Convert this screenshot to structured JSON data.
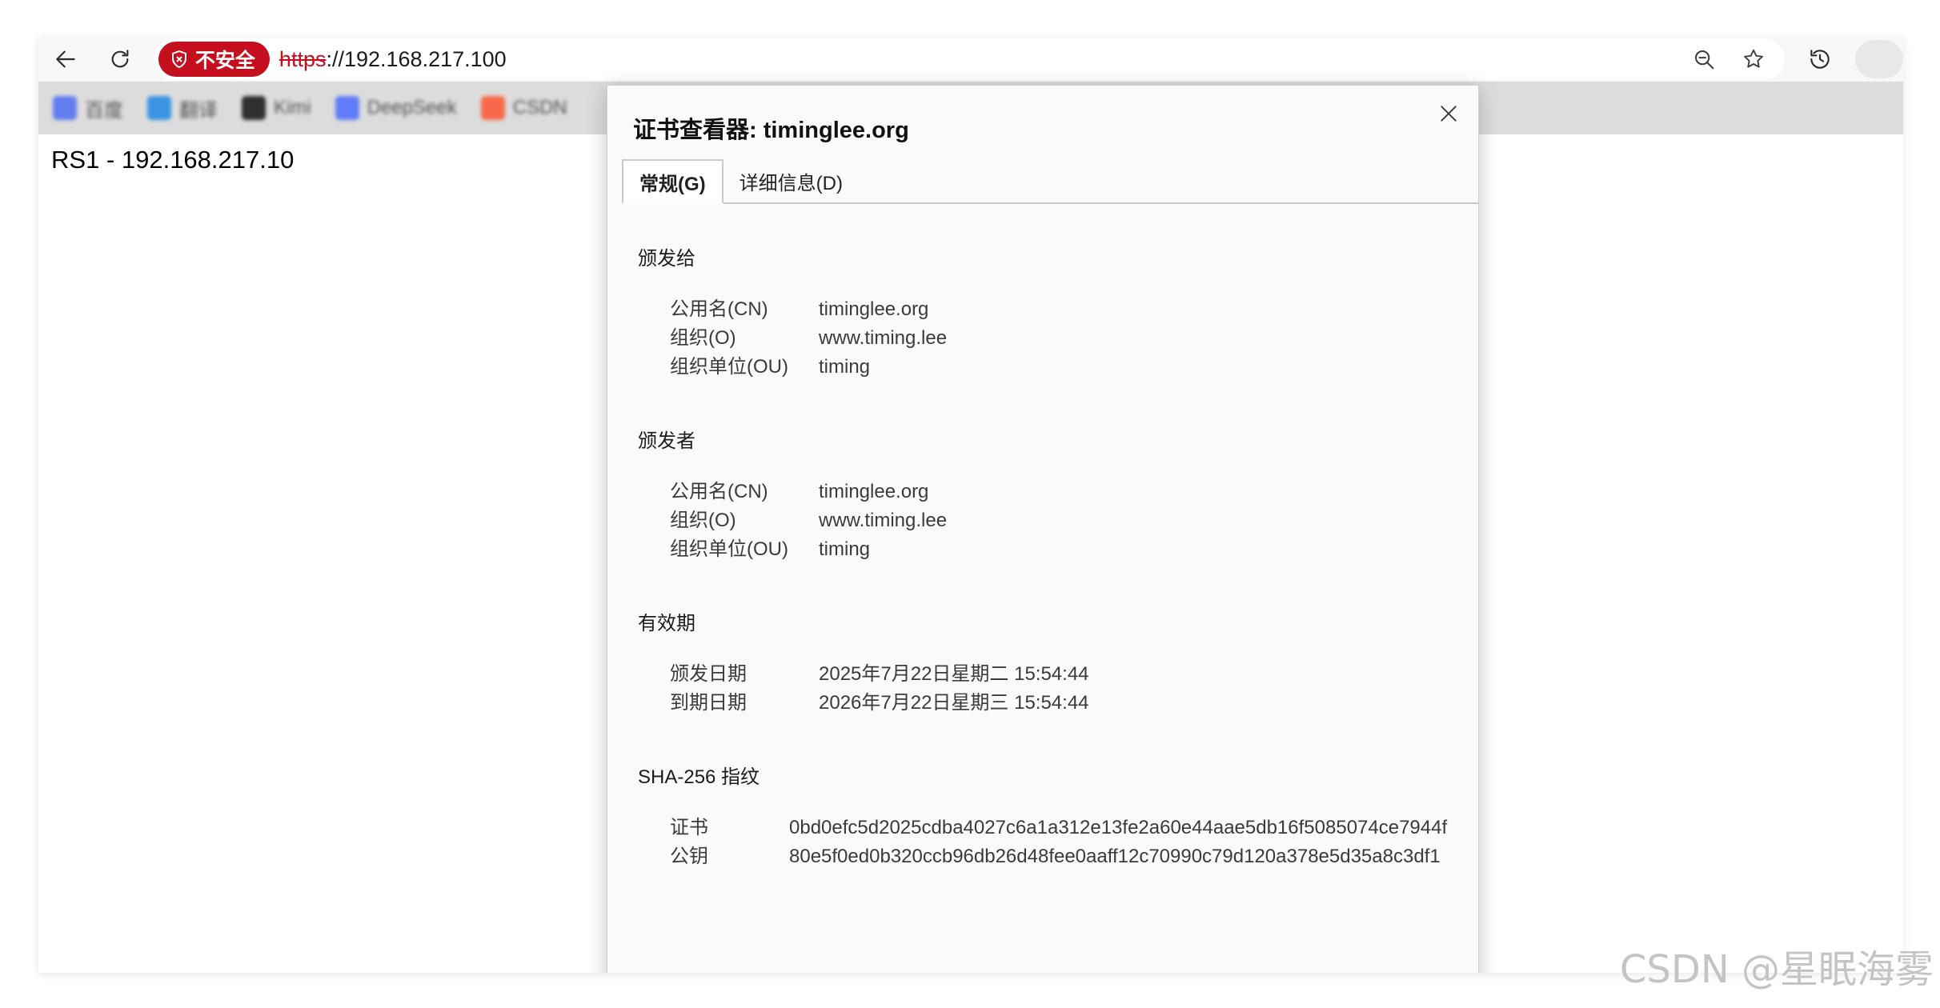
{
  "browser": {
    "security_badge": "不安全",
    "url_scheme": "https",
    "url_rest": "://192.168.217.100",
    "bookmarks": [
      {
        "label": "百度",
        "color": "#4e6ef2"
      },
      {
        "label": "翻译",
        "color": "#1e88e5"
      },
      {
        "label": "Kimi",
        "color": "#111111"
      },
      {
        "label": "DeepSeek",
        "color": "#4d6bfe"
      },
      {
        "label": "CSDN",
        "color": "#fc5531"
      }
    ]
  },
  "page": {
    "text": "RS1 - 192.168.217.10"
  },
  "dialog": {
    "title": "证书查看器: timinglee.org",
    "tabs": [
      {
        "label": "常规(G)",
        "active": true
      },
      {
        "label": "详细信息(D)",
        "active": false
      }
    ],
    "issued_to": {
      "title": "颁发给",
      "rows": [
        {
          "key": "公用名(CN)",
          "value": "timinglee.org"
        },
        {
          "key": "组织(O)",
          "value": "www.timing.lee"
        },
        {
          "key": "组织单位(OU)",
          "value": "timing"
        }
      ]
    },
    "issued_by": {
      "title": "颁发者",
      "rows": [
        {
          "key": "公用名(CN)",
          "value": "timinglee.org"
        },
        {
          "key": "组织(O)",
          "value": "www.timing.lee"
        },
        {
          "key": "组织单位(OU)",
          "value": "timing"
        }
      ]
    },
    "validity": {
      "title": "有效期",
      "rows": [
        {
          "key": "颁发日期",
          "value": "2025年7月22日星期二 15:54:44"
        },
        {
          "key": "到期日期",
          "value": "2026年7月22日星期三 15:54:44"
        }
      ]
    },
    "fingerprint": {
      "title": "SHA-256 指纹",
      "rows": [
        {
          "key": "证书",
          "value": "0bd0efc5d2025cdba4027c6a1a312e13fe2a60e44aae5db16f5085074ce7944f"
        },
        {
          "key": "公钥",
          "value": "80e5f0ed0b320ccb96db26d48fee0aaff12c70990c79d120a378e5d35a8c3df1"
        }
      ]
    }
  },
  "watermark": "CSDN @星眠海雾"
}
